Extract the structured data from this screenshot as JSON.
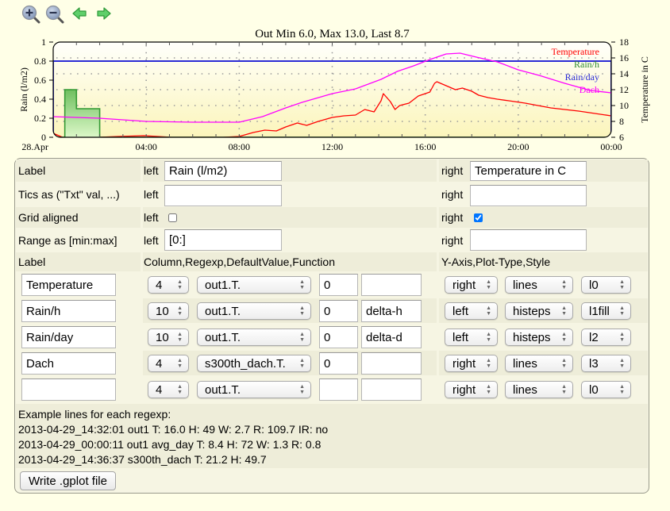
{
  "toolbar": {
    "icons": [
      "zoom-in-icon",
      "zoom-out-icon",
      "previous-arrow-icon",
      "next-arrow-icon"
    ]
  },
  "chart_data": {
    "type": "line",
    "title": "Out Min 6.0, Max 13.0, Last 8.7",
    "xlabel": "",
    "ylabel": "Rain (l/m2)",
    "ylabel_right": "Temperature in C",
    "x_unit": "hours since 28.Apr 00:00",
    "x_range": [
      0,
      24
    ],
    "x_ticks": [
      {
        "hour": 0,
        "label": "28.Apr"
      },
      {
        "hour": 4,
        "label": "04:00"
      },
      {
        "hour": 8,
        "label": "08:00"
      },
      {
        "hour": 12,
        "label": "12:00"
      },
      {
        "hour": 16,
        "label": "16:00"
      },
      {
        "hour": 20,
        "label": "20:00"
      },
      {
        "hour": 24,
        "label": "00:00"
      }
    ],
    "y_left": {
      "range": [
        0,
        1
      ],
      "ticks": [
        0,
        0.2,
        0.4,
        0.6,
        0.8,
        1
      ],
      "tick_labels": [
        "0",
        "0.2",
        "0.4",
        "0.6",
        "0.8",
        "1"
      ]
    },
    "y_right": {
      "range": [
        6,
        18
      ],
      "ticks": [
        6,
        8,
        10,
        12,
        14,
        16,
        18
      ],
      "tick_labels": [
        "6",
        "8",
        "10",
        "12",
        "14",
        "16",
        "18"
      ]
    },
    "grid": {
      "horizontal": "aligned to right axis",
      "vertical": true
    },
    "legend_position": "top-right",
    "series": [
      {
        "name": "Temperature",
        "axis": "right",
        "plot": "lines",
        "color": "#ff0000",
        "points": [
          [
            0,
            6.5
          ],
          [
            0.4,
            6.0
          ],
          [
            1.1,
            6.0
          ],
          [
            2.0,
            6.0
          ],
          [
            2.8,
            6.1
          ],
          [
            3.9,
            6.2
          ],
          [
            4.5,
            6.1
          ],
          [
            5.1,
            6.0
          ],
          [
            6.3,
            6.0
          ],
          [
            7.3,
            6.0
          ],
          [
            8.0,
            6.1
          ],
          [
            8.6,
            6.6
          ],
          [
            9.1,
            6.9
          ],
          [
            9.6,
            6.8
          ],
          [
            10.0,
            7.3
          ],
          [
            10.5,
            7.8
          ],
          [
            10.9,
            7.5
          ],
          [
            11.4,
            8.0
          ],
          [
            12.0,
            8.5
          ],
          [
            12.5,
            8.7
          ],
          [
            13.0,
            8.8
          ],
          [
            13.4,
            9.5
          ],
          [
            13.8,
            9.2
          ],
          [
            14.1,
            10.6
          ],
          [
            14.2,
            11.5
          ],
          [
            14.5,
            10.5
          ],
          [
            14.7,
            9.5
          ],
          [
            14.9,
            10.0
          ],
          [
            15.3,
            10.3
          ],
          [
            15.7,
            11.2
          ],
          [
            16.2,
            11.7
          ],
          [
            16.4,
            12.8
          ],
          [
            16.5,
            13.0
          ],
          [
            16.9,
            12.5
          ],
          [
            17.3,
            12.0
          ],
          [
            17.6,
            12.2
          ],
          [
            18.0,
            11.8
          ],
          [
            18.3,
            11.3
          ],
          [
            18.7,
            11.0
          ],
          [
            19.1,
            10.8
          ],
          [
            19.6,
            10.6
          ],
          [
            20.3,
            10.3
          ],
          [
            21.4,
            9.7
          ],
          [
            22.6,
            9.3
          ],
          [
            24.0,
            8.7
          ]
        ]
      },
      {
        "name": "Rain/h",
        "axis": "left",
        "plot": "histeps",
        "fill": true,
        "color": "#339933",
        "steps": [
          {
            "from": 0,
            "to": 0.5,
            "value": 0
          },
          {
            "from": 0.5,
            "to": 1.0,
            "value": 0.5
          },
          {
            "from": 1.0,
            "to": 2.0,
            "value": 0.3
          },
          {
            "from": 2.0,
            "to": 24,
            "value": 0
          }
        ]
      },
      {
        "name": "Rain/day",
        "axis": "left",
        "plot": "histeps",
        "fill": false,
        "color": "#2b2bd6",
        "steps": [
          {
            "from": 0,
            "to": 24,
            "value": 0.8
          }
        ]
      },
      {
        "name": "Dach",
        "axis": "right",
        "plot": "lines",
        "color": "#ff00ff",
        "points": [
          [
            0,
            8.6
          ],
          [
            1,
            8.5
          ],
          [
            2,
            8.4
          ],
          [
            3,
            8.2
          ],
          [
            4,
            8.0
          ],
          [
            6,
            7.9
          ],
          [
            8,
            7.9
          ],
          [
            9,
            8.6
          ],
          [
            10,
            9.7
          ],
          [
            10.7,
            10.4
          ],
          [
            12,
            11.5
          ],
          [
            13,
            12.1
          ],
          [
            14.1,
            13.3
          ],
          [
            14.8,
            14.3
          ],
          [
            15.5,
            15.0
          ],
          [
            16.2,
            15.8
          ],
          [
            16.9,
            16.5
          ],
          [
            17.5,
            16.6
          ],
          [
            18.2,
            16.1
          ],
          [
            19.1,
            15.5
          ],
          [
            20,
            14.5
          ],
          [
            20.9,
            13.8
          ],
          [
            22,
            12.8
          ],
          [
            23.1,
            11.9
          ],
          [
            24,
            11.6
          ]
        ]
      }
    ]
  },
  "form": {
    "axis_rows": [
      {
        "label": "Label",
        "left_prefix": "left",
        "left_value": "Rain (l/m2)",
        "right_prefix": "right",
        "right_value": "Temperature in C"
      },
      {
        "label": "Tics as (\"Txt\" val, ...)",
        "left_prefix": "left",
        "left_value": "",
        "right_prefix": "right",
        "right_value": ""
      },
      {
        "label": "Grid aligned",
        "left_prefix": "left",
        "left_checked": false,
        "right_prefix": "right",
        "right_checked": true
      },
      {
        "label": "Range as [min:max]",
        "left_prefix": "left",
        "left_value": "[0:]",
        "right_prefix": "right",
        "right_value": ""
      }
    ],
    "series_header": {
      "label": "Label",
      "middle": "Column,Regexp,DefaultValue,Function",
      "right": "Y-Axis,Plot-Type,Style"
    },
    "series_rows": [
      {
        "label": "Temperature",
        "column": "4",
        "regexp": "out1.T.",
        "default": "0",
        "function": "",
        "yaxis": "right",
        "plottype": "lines",
        "style": "l0"
      },
      {
        "label": "Rain/h",
        "column": "10",
        "regexp": "out1.T.",
        "default": "0",
        "function": "delta-h",
        "yaxis": "left",
        "plottype": "histeps",
        "style": "l1fill"
      },
      {
        "label": "Rain/day",
        "column": "10",
        "regexp": "out1.T.",
        "default": "0",
        "function": "delta-d",
        "yaxis": "left",
        "plottype": "histeps",
        "style": "l2"
      },
      {
        "label": "Dach",
        "column": "4",
        "regexp": "s300th_dach.T.",
        "default": "0",
        "function": "",
        "yaxis": "right",
        "plottype": "lines",
        "style": "l3"
      },
      {
        "label": "",
        "column": "4",
        "regexp": "out1.T.",
        "default": "",
        "function": "",
        "yaxis": "right",
        "plottype": "lines",
        "style": "l0"
      }
    ],
    "examples": {
      "heading": "Example lines for each regexp:",
      "lines": [
        "2013-04-29_14:32:01 out1 T: 16.0 H: 49 W: 2.7 R: 109.7 IR: no",
        "2013-04-29_00:00:11 out1 avg_day T: 8.4 H: 72 W: 1.3 R: 0.8",
        "2013-04-29_14:36:37 s300th_dach T: 21.2 H: 49.7"
      ]
    },
    "write_button": "Write .gplot file"
  }
}
